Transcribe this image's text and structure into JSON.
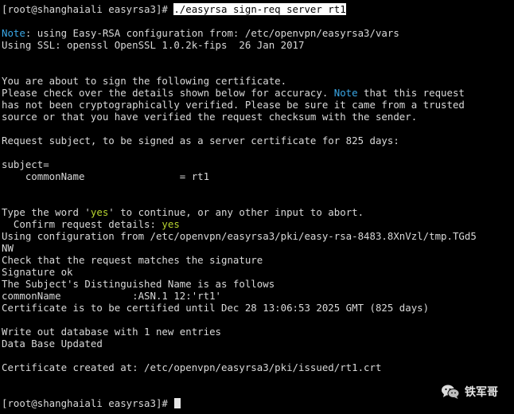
{
  "terminal": {
    "prompt": "[root@shanghaiali easyrsa3]# ",
    "command": "./easyrsa sign-req server rt1",
    "lines": {
      "l3a": "Note",
      "l3b": ": using Easy-RSA configuration from: /etc/openvpn/easyrsa3/vars",
      "l4": "Using SSL: openssl OpenSSL 1.0.2k-fips  26 Jan 2017",
      "l7": "You are about to sign the following certificate.",
      "l8a": "Please check over the details shown below for accuracy. ",
      "l8b": "Note",
      "l8c": " that this request",
      "l9": "has not been cryptographically verified. Please be sure it came from a trusted",
      "l10": "source or that you have verified the request checksum with the sender.",
      "l12": "Request subject, to be signed as a server certificate for 825 days:",
      "l14": "subject=",
      "l15": "    commonName                = rt1",
      "l18a": "Type the word '",
      "l18b": "yes",
      "l18c": "' to continue, or any other input to abort.",
      "l19a": "  Confirm request details: ",
      "l19b": "yes",
      "l20": "Using configuration from /etc/openvpn/easyrsa3/pki/easy-rsa-8483.8XnVzl/tmp.TGd5",
      "l21": "NW",
      "l22": "Check that the request matches the signature",
      "l23": "Signature ok",
      "l24": "The Subject's Distinguished Name is as follows",
      "l25": "commonName            :ASN.1 12:'rt1'",
      "l26": "Certificate is to be certified until Dec 28 13:06:53 2025 GMT (825 days)",
      "l28": "Write out database with 1 new entries",
      "l29": "Data Base Updated",
      "l31": "Certificate created at: /etc/openvpn/easyrsa3/pki/issued/rt1.crt",
      "final_prompt": "[root@shanghaiali easyrsa3]# "
    }
  },
  "watermark": {
    "text": "铁军哥",
    "icon": "wechat-icon"
  },
  "colors": {
    "background": "#000000",
    "text": "#d9d9d9",
    "note": "#3aa7e6",
    "yes": "#b8d430",
    "command_highlight": "#ffffff"
  }
}
